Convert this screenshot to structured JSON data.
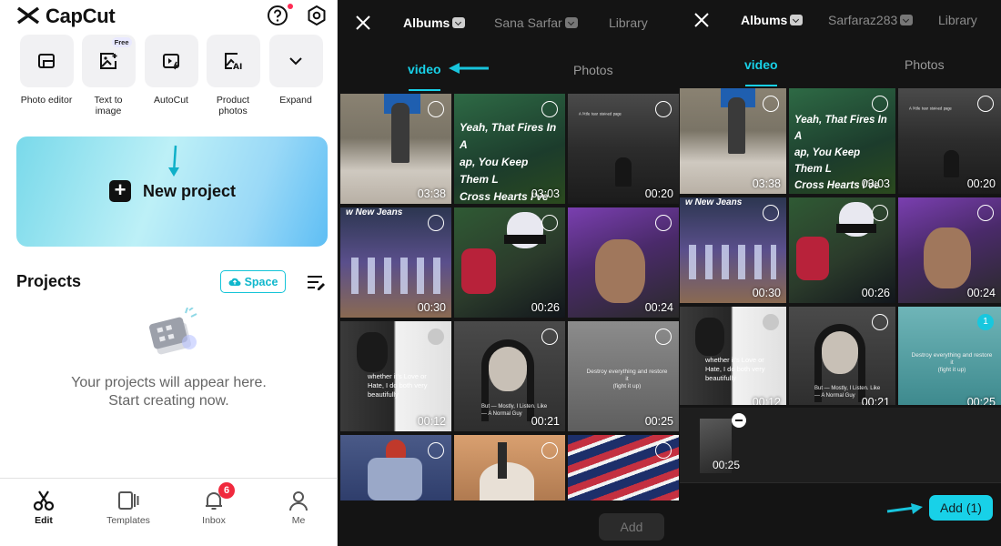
{
  "home": {
    "brand": "CapCut",
    "tools": [
      {
        "label": "Photo editor",
        "icon": "photo-editor-icon"
      },
      {
        "label": "Text to image",
        "icon": "text-to-image-icon",
        "badge": "Free"
      },
      {
        "label": "AutoCut",
        "icon": "autocut-icon"
      },
      {
        "label": "Product photos",
        "icon": "product-photos-icon"
      },
      {
        "label": "Expand",
        "icon": "chevron-down-icon"
      }
    ],
    "new_project": "New project",
    "projects_title": "Projects",
    "space_label": "Space",
    "empty_line1": "Your projects will appear here.",
    "empty_line2": "Start creating now.",
    "nav": [
      {
        "label": "Edit",
        "active": true
      },
      {
        "label": "Templates"
      },
      {
        "label": "Inbox",
        "badge": "6"
      },
      {
        "label": "Me"
      }
    ]
  },
  "picker1": {
    "tabs": [
      "Albums",
      "Sana Sarfar",
      "Library"
    ],
    "sub_tabs": [
      "video",
      "Photos"
    ],
    "add_label": "Add",
    "thumbs": [
      {
        "duration": "03:38"
      },
      {
        "duration": "03:03",
        "caption": "Yeah, That Fires In A\nap, You Keep Them L\nCross Hearts I've Bee\nThe One To Ride"
      },
      {
        "duration": "00:20"
      },
      {
        "duration": "00:30",
        "caption": "w New Jeans"
      },
      {
        "duration": "00:26"
      },
      {
        "duration": "00:24"
      },
      {
        "duration": "00:12",
        "caption": "whether it's Love or\nHate, I do both very\nbeautifully"
      },
      {
        "duration": "00:21",
        "caption": "But — Mostly, I Listen. Like\n— A Normal Guy"
      },
      {
        "duration": "00:25",
        "caption": "Destroy everything and restore it\n(fight it up)"
      },
      {
        "duration": ""
      },
      {
        "duration": ""
      },
      {
        "duration": ""
      }
    ]
  },
  "picker2": {
    "tabs": [
      "Albums",
      "Sarfaraz283",
      "Library"
    ],
    "sub_tabs": [
      "video",
      "Photos"
    ],
    "selected_count_badge": "1",
    "tray_duration": "00:25",
    "add_label": "Add (1)",
    "thumbs": [
      {
        "duration": "03:38"
      },
      {
        "duration": "03:03",
        "caption": "Yeah, That Fires In A\nap, You Keep Them L\nCross Hearts I've Bee\nThe One To Ride"
      },
      {
        "duration": "00:20"
      },
      {
        "duration": "00:30",
        "caption": "w New Jeans"
      },
      {
        "duration": "00:26"
      },
      {
        "duration": "00:24"
      },
      {
        "duration": "00:12",
        "caption": "whether it's Love or\nHate, I do both very\nbeautifully"
      },
      {
        "duration": "00:21",
        "caption": "But — Mostly, I Listen. Like\n— A Normal Guy"
      },
      {
        "duration": "00:25",
        "caption": "Destroy everything and restore it\n(fight it up)"
      }
    ]
  },
  "colors": {
    "accent": "#18d1e8",
    "badge_red": "#f0293d"
  }
}
